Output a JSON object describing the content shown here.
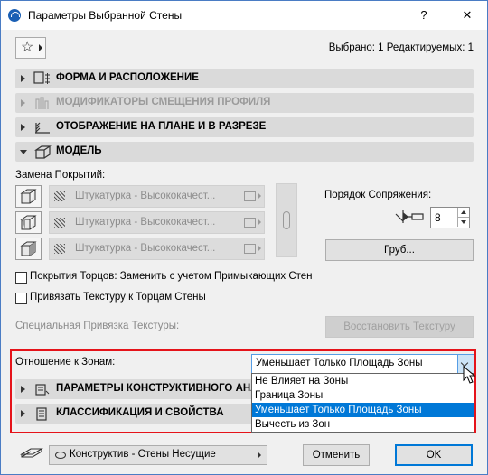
{
  "window": {
    "title": "Параметры Выбранной Стены",
    "help_label": "?",
    "close_label": "✕"
  },
  "selection_info": "Выбрано: 1 Редактируемых: 1",
  "panels": [
    {
      "label": "ФОРМА И РАСПОЛОЖЕНИЕ",
      "expanded": false,
      "enabled": true
    },
    {
      "label": "МОДИФИКАТОРЫ СМЕЩЕНИЯ ПРОФИЛЯ",
      "expanded": false,
      "enabled": false
    },
    {
      "label": "ОТОБРАЖЕНИЕ НА ПЛАНЕ И В РАЗРЕЗЕ",
      "expanded": false,
      "enabled": true
    },
    {
      "label": "МОДЕЛЬ",
      "expanded": true,
      "enabled": true
    }
  ],
  "model": {
    "override_surfaces_label": "Замена Покрытий:",
    "surfaces": [
      {
        "name": "Штукатурка - Высококачест..."
      },
      {
        "name": "Штукатурка - Высококачест..."
      },
      {
        "name": "Штукатурка - Высококачест..."
      }
    ],
    "junction_order_label": "Порядок Сопряжения:",
    "junction_order_value": "8",
    "rough_button": "Груб...",
    "edge_surfaces_label": "Покрытия Торцов: Заменить с учетом Примыкающих Стен",
    "bind_texture_label": "Привязать Текстуру к Торцам Стены",
    "custom_texture_label": "Специальная Привязка Текстуры:",
    "restore_texture_button": "Восстановить Текстуру",
    "zone_relation_label": "Отношение к Зонам:",
    "zone_relation_value": "Уменьшает Только Площадь Зоны",
    "zone_relation_options": [
      "Не Влияет на Зоны",
      "Граница Зоны",
      "Уменьшает Только Площадь Зоны",
      "Вычесть из Зон"
    ],
    "zone_relation_selected_index": 2
  },
  "lower_panels": [
    {
      "label": "ПАРАМЕТРЫ КОНСТРУКТИВНОГО АНАЛ"
    },
    {
      "label": "КЛАССИФИКАЦИЯ И СВОЙСТВА"
    }
  ],
  "footer": {
    "layer_value": "Конструктив - Стены Несущие",
    "cancel_button": "Отменить",
    "ok_button": "OK"
  },
  "colors": {
    "highlight_box": "#e5131a",
    "selection": "#0078d7"
  }
}
